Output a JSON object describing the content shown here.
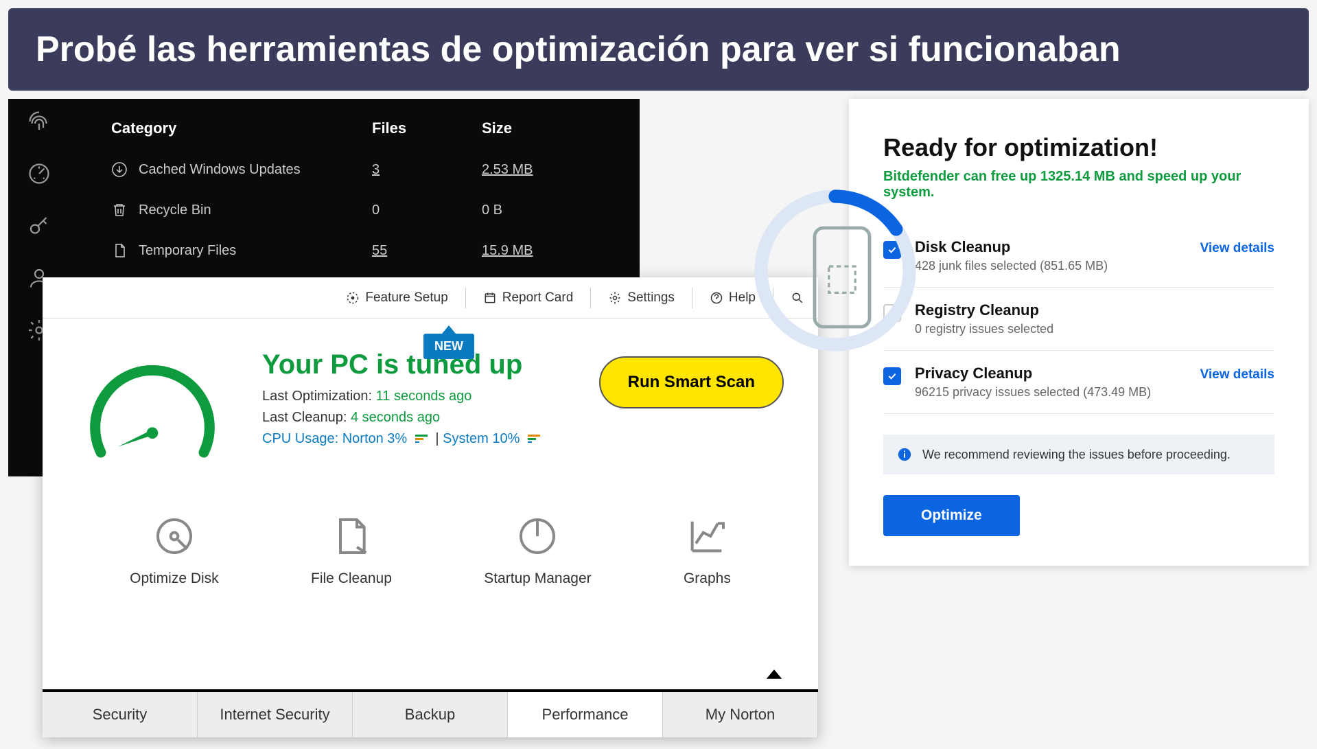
{
  "banner": {
    "title": "Probé las herramientas de optimización para ver si funcionaban"
  },
  "dark": {
    "headers": {
      "category": "Category",
      "files": "Files",
      "size": "Size"
    },
    "rows": [
      {
        "name": "Cached Windows Updates",
        "files": "3",
        "size": "2.53 MB",
        "underline": true
      },
      {
        "name": "Recycle Bin",
        "files": "0",
        "size": "0 B",
        "underline": false
      },
      {
        "name": "Temporary Files",
        "files": "55",
        "size": "15.9 MB",
        "underline": true
      }
    ]
  },
  "norton": {
    "topbar": {
      "feature": "Feature Setup",
      "report": "Report Card",
      "settings": "Settings",
      "help": "Help"
    },
    "new_label": "NEW",
    "status": {
      "title": "Your PC is tuned up",
      "last_opt_lbl": "Last Optimization:",
      "last_opt_val": "11 seconds ago",
      "last_clean_lbl": "Last Cleanup:",
      "last_clean_val": "4 seconds ago",
      "cpu_lbl": "CPU Usage:",
      "cpu_norton": "Norton 3%",
      "cpu_sep": "|",
      "cpu_system": "System 10%"
    },
    "scan_btn": "Run Smart Scan",
    "tools": {
      "optimize": "Optimize Disk",
      "cleanup": "File Cleanup",
      "startup": "Startup Manager",
      "graphs": "Graphs"
    },
    "tabs": {
      "security": "Security",
      "internet": "Internet Security",
      "backup": "Backup",
      "performance": "Performance",
      "mynorton": "My Norton"
    }
  },
  "bd": {
    "title": "Ready for optimization!",
    "subtitle": "Bitdefender can free up 1325.14 MB and speed up your system.",
    "items": [
      {
        "title": "Disk Cleanup",
        "desc": "428 junk files selected (851.65 MB)",
        "checked": true,
        "details": "View details"
      },
      {
        "title": "Registry Cleanup",
        "desc": "0 registry issues selected",
        "checked": false,
        "details": ""
      },
      {
        "title": "Privacy Cleanup",
        "desc": "96215 privacy issues selected (473.49 MB)",
        "checked": true,
        "details": "View details"
      }
    ],
    "note": "We recommend reviewing the issues before proceeding.",
    "optimize_btn": "Optimize"
  }
}
